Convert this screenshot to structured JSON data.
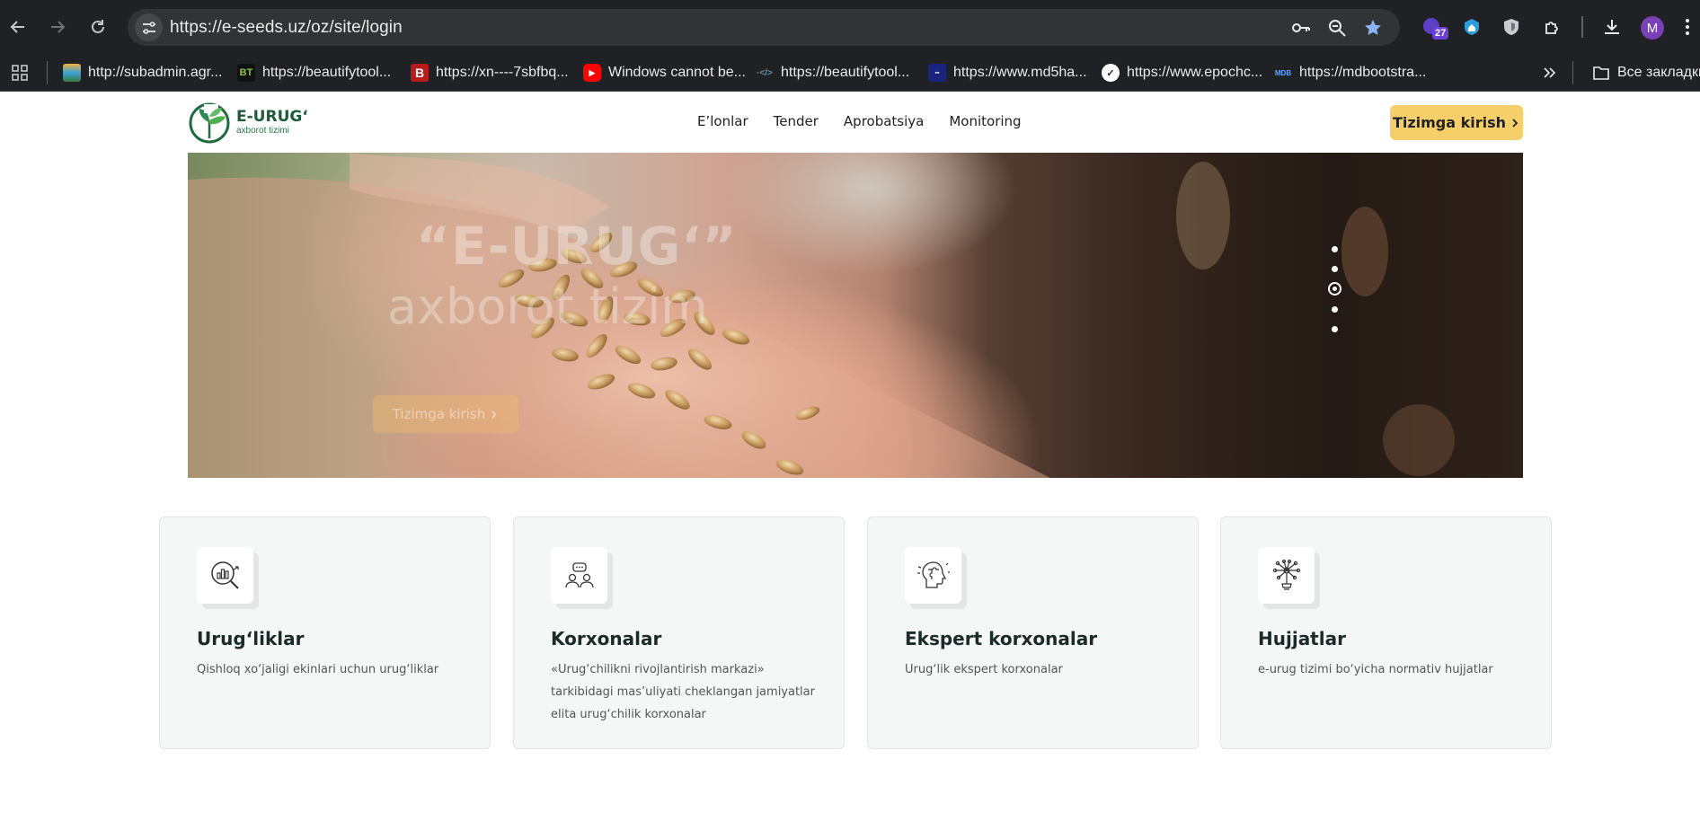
{
  "browser": {
    "url": "https://e-seeds.uz/oz/site/login",
    "extension_badge": "27",
    "profile_initial": "M",
    "bookmarks": [
      {
        "label": "http://subadmin.agr...",
        "icon": "layers-favicon"
      },
      {
        "label": "https://beautifytool...",
        "icon": "bt-favicon"
      },
      {
        "label": "https://xn----7sbfbq...",
        "icon": "b-favicon"
      },
      {
        "label": "Windows cannot be...",
        "icon": "youtube-favicon"
      },
      {
        "label": "https://beautifytool...",
        "icon": "beautify-favicon"
      },
      {
        "label": "https://www.md5ha...",
        "icon": "md5-favicon"
      },
      {
        "label": "https://www.epochc...",
        "icon": "epoch-favicon"
      },
      {
        "label": "https://mdbootstra...",
        "icon": "mdb-favicon"
      }
    ],
    "all_bookmarks_label": "Все закладки"
  },
  "site": {
    "logo": {
      "title": "E-URUG‘",
      "subtitle": "axborot tizimi"
    },
    "nav": [
      "E’lonlar",
      "Tender",
      "Aprobatsiya",
      "Monitoring"
    ],
    "login_button": "Tizimga kirish",
    "hero": {
      "title": "“E-URUG‘”",
      "subtitle": "axborot tizim",
      "button": "Tizimga kirish",
      "slides": 5,
      "active_slide": 3
    },
    "cards": [
      {
        "title": "Urug‘liklar",
        "desc": "Qishloq xo‘jaligi ekinlari uchun urug‘liklar",
        "icon": "chart-magnifier-icon"
      },
      {
        "title": "Korxonalar",
        "desc": "«Urug‘chilikni rivojlantirish markazi» tarkibidagi mas’uliyati cheklangan jamiyatlar elita urug‘chilik korxonalar",
        "icon": "people-chat-icon"
      },
      {
        "title": "Ekspert korxonalar",
        "desc": "Urug‘lik ekspert korxonalar",
        "icon": "puzzle-head-icon"
      },
      {
        "title": "Hujjatlar",
        "desc": "e-urug tizimi bo‘yicha normativ hujjatlar",
        "icon": "idea-network-icon"
      }
    ],
    "colors": {
      "accent": "#f6cf6a",
      "brand_green": "#1c5b3a",
      "card_bg": "#f5f6f6"
    }
  }
}
